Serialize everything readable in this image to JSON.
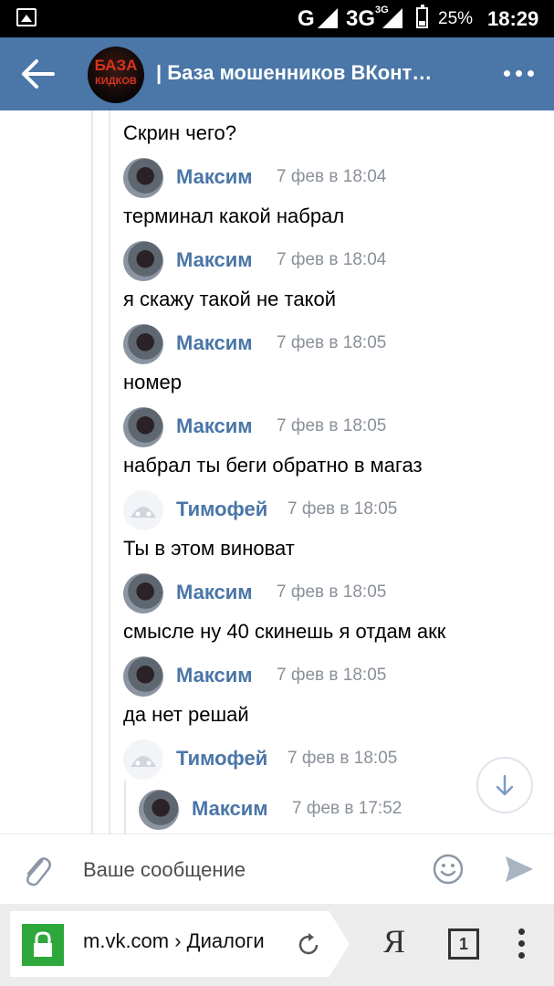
{
  "status_bar": {
    "network_1": "G",
    "network_2": "3G",
    "network_2_sup": "3G",
    "battery": "25%",
    "time": "18:29"
  },
  "header": {
    "avatar_text_line1": "БАЗА",
    "avatar_text_line2": "КИДКОВ",
    "title": "| База мошенников ВКонт…"
  },
  "messages": [
    {
      "type": "text",
      "text": "Скрин чего?"
    },
    {
      "type": "author",
      "name": "Максим",
      "date": "7 фев в 18:04",
      "avatar": "maxim"
    },
    {
      "type": "text",
      "text": "терминал какой набрал"
    },
    {
      "type": "author",
      "name": "Максим",
      "date": "7 фев в 18:04",
      "avatar": "maxim"
    },
    {
      "type": "text",
      "text": "я скажу такой не такой"
    },
    {
      "type": "author",
      "name": "Максим",
      "date": "7 фев в 18:05",
      "avatar": "maxim"
    },
    {
      "type": "text",
      "text": "номер"
    },
    {
      "type": "author",
      "name": "Максим",
      "date": "7 фев в 18:05",
      "avatar": "maxim"
    },
    {
      "type": "text",
      "text": "набрал ты беги обратно в магаз"
    },
    {
      "type": "author",
      "name": "Тимофей",
      "date": "7 фев в 18:05",
      "avatar": "timofey"
    },
    {
      "type": "text",
      "text": "Ты в этом виноват"
    },
    {
      "type": "author",
      "name": "Максим",
      "date": "7 фев в 18:05",
      "avatar": "maxim"
    },
    {
      "type": "text",
      "text": "смысле ну 40 скинешь я отдам акк"
    },
    {
      "type": "author",
      "name": "Максим",
      "date": "7 фев в 18:05",
      "avatar": "maxim"
    },
    {
      "type": "text",
      "text": "да нет решай"
    },
    {
      "type": "author",
      "name": "Тимофей",
      "date": "7 фев в 18:05",
      "avatar": "timofey"
    },
    {
      "type": "author_nested",
      "name": "Максим",
      "date": "7 фев в 17:52",
      "avatar": "maxim"
    }
  ],
  "composer": {
    "placeholder": "Ваше сообщение"
  },
  "browser": {
    "url": "m.vk.com › Диалоги",
    "ya_label": "Я",
    "tab_count": "1"
  },
  "colors": {
    "header_bg": "#4a76a8",
    "name_color": "#4a76a8",
    "lock_green": "#2ea83a"
  },
  "icons": [
    "back-arrow-icon",
    "more-icon",
    "scroll-down-icon",
    "paperclip-icon",
    "smile-icon",
    "send-icon",
    "lock-icon",
    "reload-icon",
    "tabs-icon",
    "menu-icon"
  ]
}
